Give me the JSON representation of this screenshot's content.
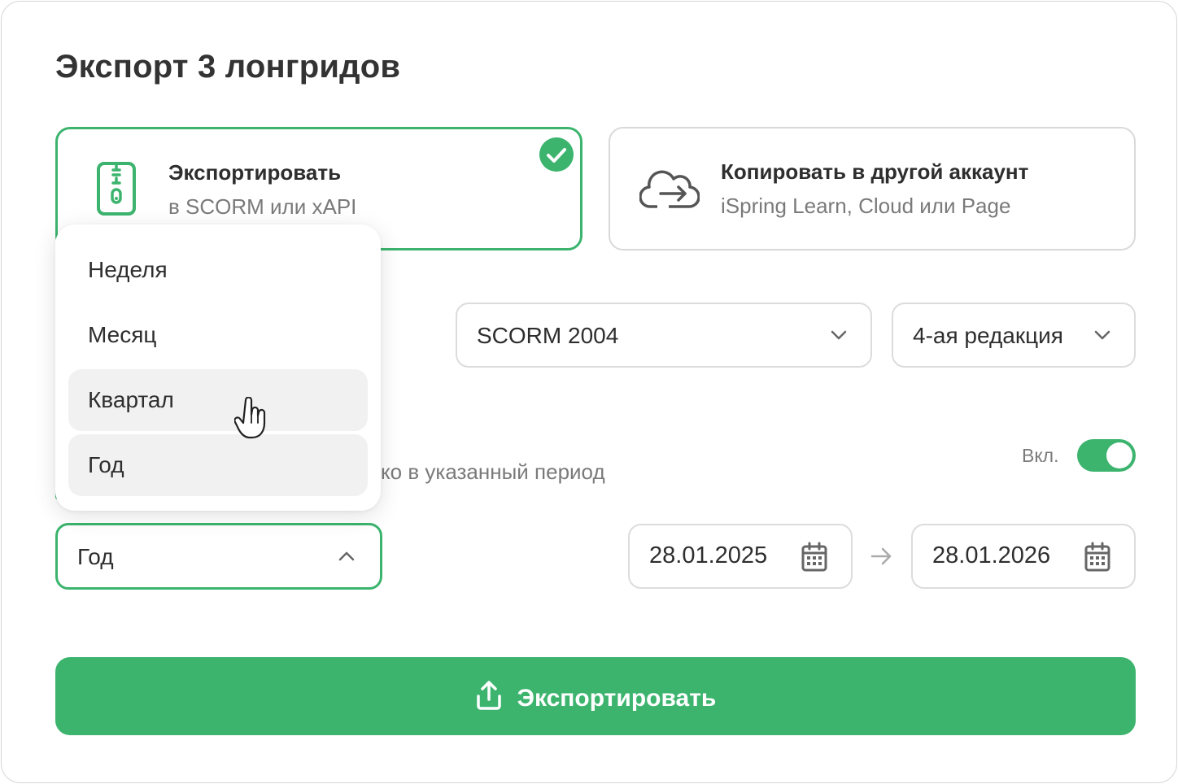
{
  "dialog": {
    "title": "Экспорт 3 лонгридов"
  },
  "options": [
    {
      "title": "Экспортировать",
      "subtitle": "в SCORM или xAPI",
      "selected": true,
      "icon": "zip-file-icon"
    },
    {
      "title": "Копировать в другой аккаунт",
      "subtitle": "iSpring Learn, Cloud или Page",
      "selected": false,
      "icon": "cloud-upload-icon"
    }
  ],
  "format": {
    "standard": "SCORM 2004",
    "edition": "4-ая редакция"
  },
  "period_filter": {
    "description_visible": "ко в указанный период",
    "toggle_label": "Вкл.",
    "toggle_on": true,
    "period_value": "Год",
    "date_from": "28.01.2025",
    "date_to": "28.01.2026"
  },
  "period_dropdown": {
    "items": [
      "Неделя",
      "Месяц",
      "Квартал",
      "Год"
    ],
    "hovered": "Квартал",
    "selected": "Год"
  },
  "export_button": {
    "label": "Экспортировать"
  },
  "colors": {
    "accent": "#3cb46e",
    "border": "#dcdcdc",
    "muted_text": "#7a7a7a"
  }
}
